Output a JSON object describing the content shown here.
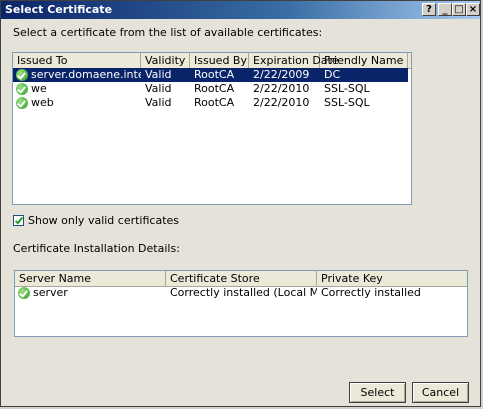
{
  "window": {
    "title": "Select Certificate"
  },
  "prompt": "Select a certificate from the list of available certificates:",
  "cert_table": {
    "columns": [
      "Issued To",
      "Validity",
      "Issued By",
      "Expiration Date",
      "Friendly Name"
    ],
    "rows": [
      {
        "issued_to": "server.domaene.internal",
        "validity": "Valid",
        "issued_by": "RootCA",
        "expiration": "2/22/2009",
        "friendly": "DC"
      },
      {
        "issued_to": "we",
        "validity": "Valid",
        "issued_by": "RootCA",
        "expiration": "2/22/2010",
        "friendly": "SSL-SQL"
      },
      {
        "issued_to": "web",
        "validity": "Valid",
        "issued_by": "RootCA",
        "expiration": "2/22/2010",
        "friendly": "SSL-SQL"
      }
    ]
  },
  "show_valid_label": "Show only valid certificates",
  "details_label": "Certificate Installation Details:",
  "details_table": {
    "columns": [
      "Server Name",
      "Certificate Store",
      "Private Key"
    ],
    "rows": [
      {
        "server": "server",
        "store": "Correctly installed (Local Machine,...",
        "key": "Correctly installed"
      }
    ]
  },
  "buttons": {
    "select": "Select",
    "cancel": "Cancel"
  }
}
